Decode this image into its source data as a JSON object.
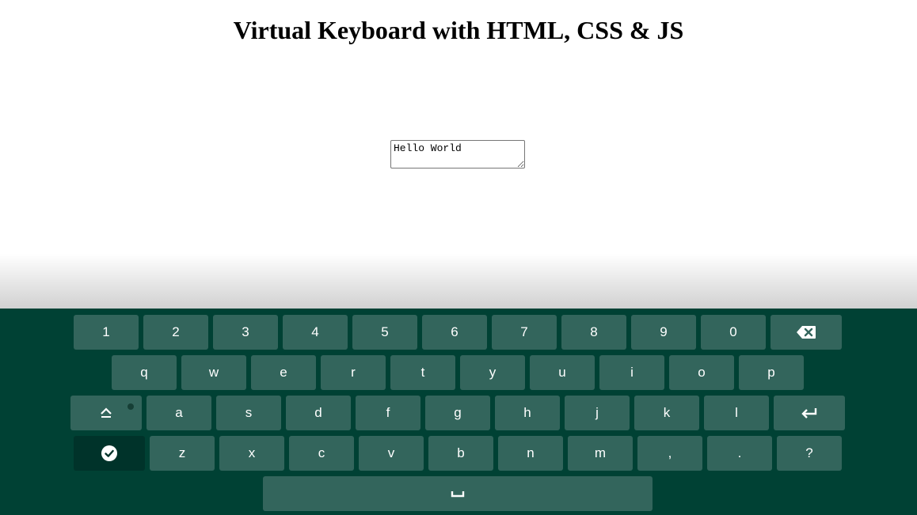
{
  "page": {
    "title": "Virtual Keyboard with HTML, CSS & JS"
  },
  "textarea": {
    "value": "Hello World"
  },
  "keyboard": {
    "row1": [
      "1",
      "2",
      "3",
      "4",
      "5",
      "6",
      "7",
      "8",
      "9",
      "0"
    ],
    "row2": [
      "q",
      "w",
      "e",
      "r",
      "t",
      "y",
      "u",
      "i",
      "o",
      "p"
    ],
    "row3": [
      "a",
      "s",
      "d",
      "f",
      "g",
      "h",
      "j",
      "k",
      "l"
    ],
    "row4": [
      "z",
      "x",
      "c",
      "v",
      "b",
      "n",
      "m",
      ",",
      ".",
      "?"
    ],
    "icons": {
      "backspace": "backspace-icon",
      "caps": "caps-lock-icon",
      "enter": "enter-icon",
      "done": "check-circle-icon",
      "space": "space-bar-icon"
    },
    "colors": {
      "background": "#004134",
      "key": "#33655c",
      "key_dark": "#00332a"
    }
  }
}
